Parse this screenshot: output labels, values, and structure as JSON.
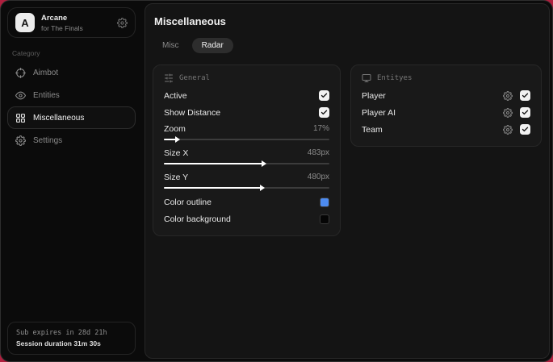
{
  "colors": {
    "desktop_background": "#b01f3e",
    "accent_blue": "#4d8bf0"
  },
  "sidebar": {
    "brand": {
      "initial": "A",
      "title": "Arcane",
      "subtitle": "for The Finals"
    },
    "category_label": "Category",
    "items": [
      {
        "id": "aimbot",
        "label": "Aimbot",
        "icon": "crosshair-icon",
        "active": false
      },
      {
        "id": "entities",
        "label": "Entities",
        "icon": "eye-icon",
        "active": false
      },
      {
        "id": "miscellaneous",
        "label": "Miscellaneous",
        "icon": "grid-icon",
        "active": true
      },
      {
        "id": "settings",
        "label": "Settings",
        "icon": "gear-icon",
        "active": false
      }
    ],
    "footer": {
      "line1": "Sub expires in 28d 21h",
      "line2": "Session duration 31m 30s"
    }
  },
  "main": {
    "title": "Miscellaneous",
    "tabs": [
      {
        "id": "misc",
        "label": "Misc",
        "active": false
      },
      {
        "id": "radar",
        "label": "Radar",
        "active": true
      }
    ],
    "panels": {
      "general": {
        "title": "General",
        "icon": "sliders-icon",
        "rows": [
          {
            "type": "checkbox",
            "label": "Active",
            "checked": true
          },
          {
            "type": "checkbox",
            "label": "Show Distance",
            "checked": true
          },
          {
            "type": "slider",
            "label": "Zoom",
            "value": "17%",
            "fill_percent": 8
          },
          {
            "type": "slider",
            "label": "Size X",
            "value": "483px",
            "fill_percent": 60
          },
          {
            "type": "slider",
            "label": "Size Y",
            "value": "480px",
            "fill_percent": 59
          },
          {
            "type": "color",
            "label": "Color outline",
            "color": "#4d8bf0"
          },
          {
            "type": "color",
            "label": "Color background",
            "color": "#050505"
          }
        ]
      },
      "entities": {
        "title": "Entityes",
        "icon": "monitor-icon",
        "rows": [
          {
            "label": "Player",
            "checked": true
          },
          {
            "label": "Player AI",
            "checked": true
          },
          {
            "label": "Team",
            "checked": true
          }
        ]
      }
    }
  }
}
